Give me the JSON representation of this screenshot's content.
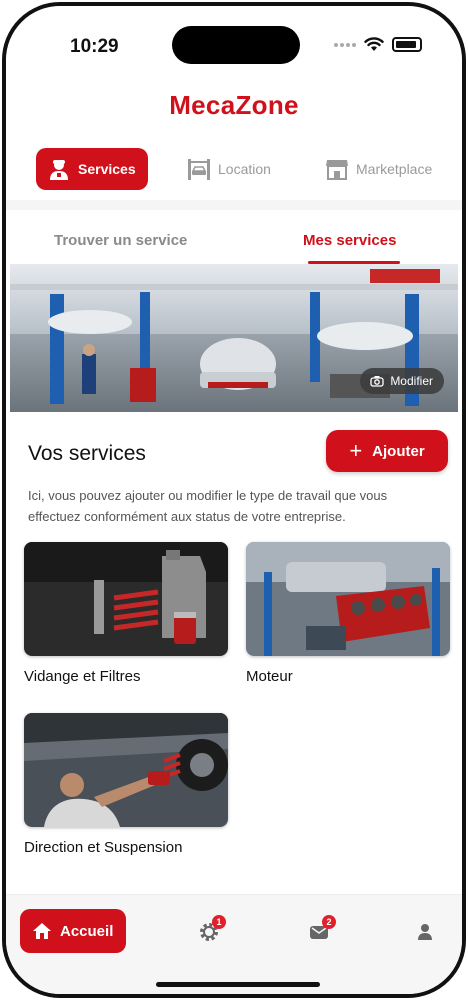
{
  "status": {
    "time": "10:29"
  },
  "app": {
    "brand": "MecaZone"
  },
  "modes": [
    {
      "label": "Services",
      "icon": "mechanic-icon",
      "active": true
    },
    {
      "label": "Location",
      "icon": "car-lift-icon",
      "active": false
    },
    {
      "label": "Marketplace",
      "icon": "store-icon",
      "active": false
    }
  ],
  "tabs": [
    {
      "label": "Trouver un service",
      "active": false
    },
    {
      "label": "Mes services",
      "active": true
    }
  ],
  "banner": {
    "modify_label": "Modifier",
    "modify_icon": "camera-icon"
  },
  "section": {
    "title": "Vos services",
    "add_label": "Ajouter",
    "description": "Ici, vous pouvez ajouter ou modifier le type de travail que vous effectuez conformément aux status de votre entreprise."
  },
  "services": [
    {
      "label": "Vidange et Filtres"
    },
    {
      "label": "Moteur"
    },
    {
      "label": "Direction et Suspension"
    }
  ],
  "bottom_nav": {
    "home_label": "Accueil",
    "items": [
      {
        "icon": "gear-icon",
        "badge": "1"
      },
      {
        "icon": "message-icon",
        "badge": "2"
      },
      {
        "icon": "user-icon",
        "badge": ""
      }
    ]
  },
  "colors": {
    "accent": "#d0101a"
  }
}
